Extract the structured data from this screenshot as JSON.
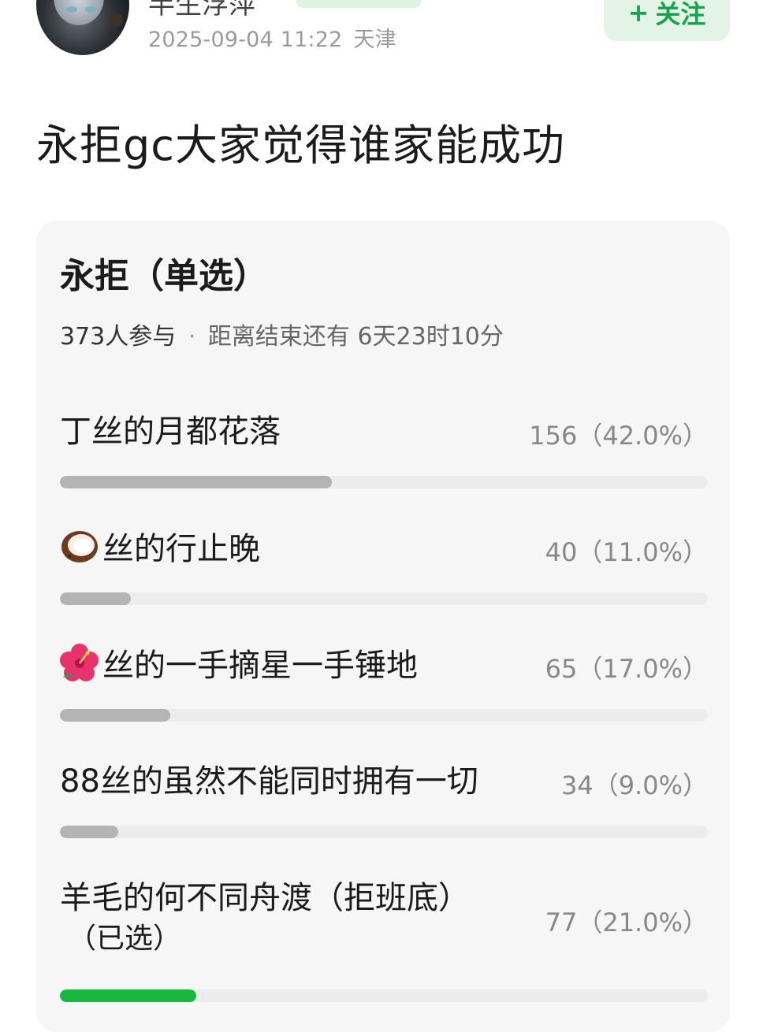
{
  "post": {
    "username": "半生浮萍",
    "datetime": "2025-09-04 11:22",
    "location": "天津",
    "follow_label": "关注",
    "follow_icon": "plus-icon",
    "title": "永拒gc大家觉得谁家能成功"
  },
  "poll": {
    "title": "永拒（单选）",
    "participants": "373人参与",
    "separator": "·",
    "remaining": "距离结束还有 6天23时10分",
    "selected_tag": "（已选）",
    "options": [
      {
        "label": "丁丝的月都花落",
        "emoji": "",
        "count_text": "156（42.0%）",
        "percent": 42.0,
        "selected": false
      },
      {
        "label": "丝的行止晚",
        "emoji": "coconut-icon",
        "count_text": "40（11.0%）",
        "percent": 11.0,
        "selected": false
      },
      {
        "label": "丝的一手摘星一手锤地",
        "emoji": "hibiscus-icon",
        "count_text": "65（17.0%）",
        "percent": 17.0,
        "selected": false
      },
      {
        "label": "88丝的虽然不能同时拥有一切",
        "emoji": "",
        "count_text": "34（9.0%）",
        "percent": 9.0,
        "selected": false
      },
      {
        "label": "羊毛的何不同舟渡（拒班底）",
        "emoji": "",
        "count_text": "77（21.0%）",
        "percent": 21.0,
        "selected": true
      }
    ],
    "colors": {
      "bar_fill": "#b4b4b4",
      "bar_selected": "#18b83e",
      "bar_track": "#ececec"
    }
  }
}
